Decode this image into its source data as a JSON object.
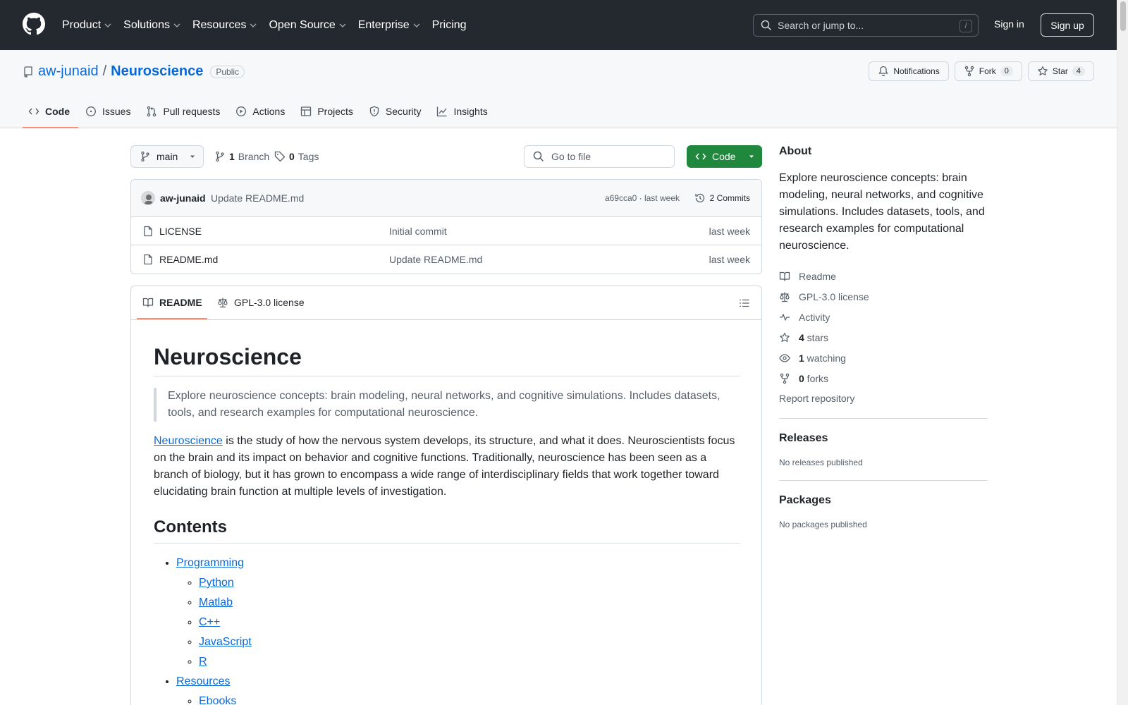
{
  "header": {
    "nav": [
      {
        "label": "Product",
        "has_dropdown": true
      },
      {
        "label": "Solutions",
        "has_dropdown": true
      },
      {
        "label": "Resources",
        "has_dropdown": true
      },
      {
        "label": "Open Source",
        "has_dropdown": true
      },
      {
        "label": "Enterprise",
        "has_dropdown": true
      },
      {
        "label": "Pricing",
        "has_dropdown": false
      }
    ],
    "search_placeholder": "Search or jump to...",
    "search_shortcut": "/",
    "signin": "Sign in",
    "signup": "Sign up"
  },
  "repo": {
    "owner": "aw-junaid",
    "separator": "/",
    "name": "Neuroscience",
    "visibility": "Public",
    "notifications_label": "Notifications",
    "fork_label": "Fork",
    "fork_count": "0",
    "star_label": "Star",
    "star_count": "4",
    "tabs": [
      {
        "label": "Code",
        "icon": "code-icon",
        "active": true
      },
      {
        "label": "Issues",
        "icon": "issue-icon",
        "active": false
      },
      {
        "label": "Pull requests",
        "icon": "pull-request-icon",
        "active": false
      },
      {
        "label": "Actions",
        "icon": "play-icon",
        "active": false
      },
      {
        "label": "Projects",
        "icon": "table-icon",
        "active": false
      },
      {
        "label": "Security",
        "icon": "shield-icon",
        "active": false
      },
      {
        "label": "Insights",
        "icon": "graph-icon",
        "active": false
      }
    ]
  },
  "filenav": {
    "branch": "main",
    "branch_count": "1",
    "branch_label": "Branch",
    "tag_count": "0",
    "tag_label": "Tags",
    "goto_placeholder": "Go to file",
    "code_button": "Code"
  },
  "commit": {
    "author": "aw-junaid",
    "message": "Update README.md",
    "meta": "a69cca0 · last week",
    "commits_label": "2 Commits"
  },
  "files": [
    {
      "name": "LICENSE",
      "message": "Initial commit",
      "date": "last week"
    },
    {
      "name": "README.md",
      "message": "Update README.md",
      "date": "last week"
    }
  ],
  "readme": {
    "tab_readme": "README",
    "tab_license": "GPL-3.0 license",
    "title": "Neuroscience",
    "quote": "Explore neuroscience concepts: brain modeling, neural networks, and cognitive simulations. Includes datasets, tools, and research examples for computational neuroscience.",
    "intro_link": "Neuroscience",
    "intro_rest": " is the study of how the nervous system develops, its structure, and what it does. Neuroscientists focus on the brain and its impact on behavior and cognitive functions. Traditionally, neuroscience has been seen as a branch of biology, but it has grown to encompass a wide range of interdisciplinary fields that work together toward elucidating brain function at multiple levels of investigation.",
    "contents_heading": "Contents",
    "toc": [
      {
        "label": "Programming",
        "children": [
          "Python",
          "Matlab",
          "C++",
          "JavaScript",
          "R"
        ]
      },
      {
        "label": "Resources",
        "children": [
          "Ebooks"
        ]
      }
    ]
  },
  "sidebar": {
    "about_heading": "About",
    "about_text": "Explore neuroscience concepts: brain modeling, neural networks, and cognitive simulations. Includes datasets, tools, and research examples for computational neuroscience.",
    "links": [
      {
        "icon": "book-icon",
        "count": "",
        "label": "Readme"
      },
      {
        "icon": "law-icon",
        "count": "",
        "label": "GPL-3.0 license"
      },
      {
        "icon": "pulse-icon",
        "count": "",
        "label": "Activity"
      },
      {
        "icon": "star-icon",
        "count": "4",
        "label": " stars"
      },
      {
        "icon": "eye-icon",
        "count": "1",
        "label": " watching"
      },
      {
        "icon": "fork-icon",
        "count": "0",
        "label": " forks"
      }
    ],
    "report": "Report repository",
    "releases_heading": "Releases",
    "releases_empty": "No releases published",
    "packages_heading": "Packages",
    "packages_empty": "No packages published"
  },
  "colors": {
    "header_bg": "#24292f",
    "link": "#0969da",
    "code_button": "#1f883d",
    "active_tab_underline": "#fd8c73"
  }
}
